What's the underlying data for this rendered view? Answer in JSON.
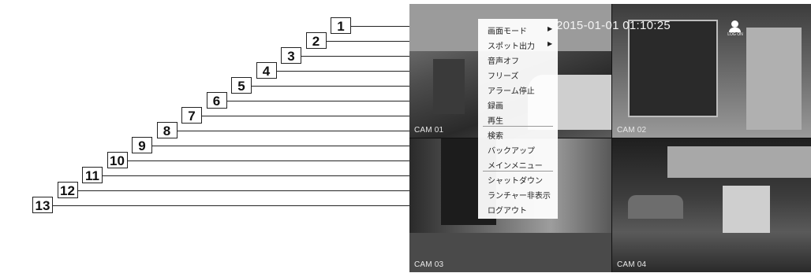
{
  "callouts": [
    "1",
    "2",
    "3",
    "4",
    "5",
    "6",
    "7",
    "8",
    "9",
    "10",
    "11",
    "12",
    "13"
  ],
  "timestamp": "2015-01-01 01:10:25",
  "logon_label": "LOG ON",
  "cameras": [
    "CAM 01",
    "CAM 02",
    "CAM 03",
    "CAM 04"
  ],
  "menu": {
    "items": [
      {
        "label": "画面モード",
        "submenu": true
      },
      {
        "label": "スポット出力",
        "submenu": true
      },
      {
        "label": "音声オフ",
        "submenu": false
      },
      {
        "label": "フリーズ",
        "submenu": false
      },
      {
        "label": "アラーム停止",
        "submenu": false
      },
      {
        "label": "録画",
        "submenu": false
      },
      {
        "label": "再生",
        "submenu": false
      },
      {
        "label": "検索",
        "submenu": false
      },
      {
        "label": "バックアップ",
        "submenu": false
      },
      {
        "label": "メインメニュー",
        "submenu": false
      },
      {
        "label": "シャットダウン",
        "submenu": false
      },
      {
        "label": "ランチャー非表示",
        "submenu": false
      },
      {
        "label": "ログアウト",
        "submenu": false
      }
    ],
    "submenu_arrow": "▶"
  }
}
